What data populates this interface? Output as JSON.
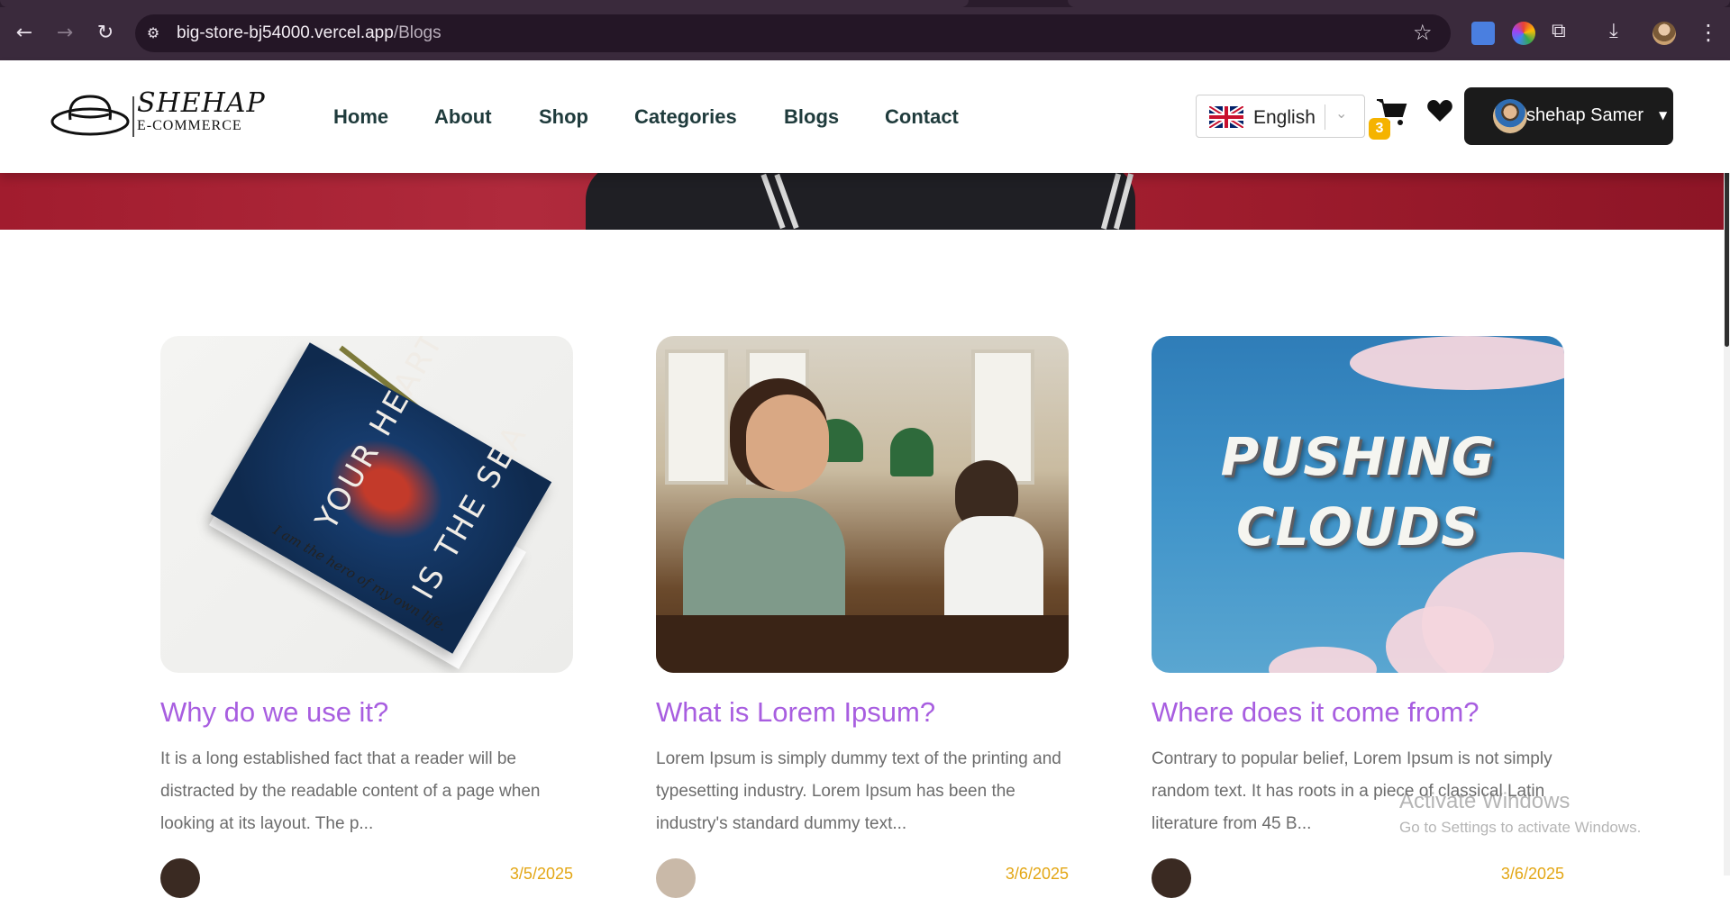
{
  "browser": {
    "url_host": "big-store-bj54000.vercel.app",
    "url_path": "/Blogs"
  },
  "site": {
    "logo_title": "SHEHAP",
    "logo_subtitle": "E-COMMERCE",
    "nav": [
      {
        "label": "Home"
      },
      {
        "label": "About"
      },
      {
        "label": "Shop"
      },
      {
        "label": "Categories"
      },
      {
        "label": "Blogs"
      },
      {
        "label": "Contact"
      }
    ],
    "language": "English",
    "cart_count": "3",
    "user_name": "shehap Samer",
    "colors": {
      "title_purple": "#a85ee0",
      "date_orange": "#e3a614",
      "nav_text": "#1f3b3c"
    }
  },
  "blogs": [
    {
      "image_text": [
        "YOUR HEART",
        "IS THE SEA",
        "I am the hero of my own life."
      ],
      "title": "Why do we use it?",
      "excerpt": "It is a long established fact that a reader will be distracted by the readable content of a page when looking at its layout. The p...",
      "date": "3/5/2025"
    },
    {
      "title": "What is Lorem Ipsum?",
      "excerpt": "Lorem Ipsum is simply dummy text of the printing and typesetting industry. Lorem Ipsum has been the industry's standard dummy text...",
      "date": "3/6/2025"
    },
    {
      "image_text": [
        "PUSHING",
        "CLOUDS"
      ],
      "title": "Where does it come from?",
      "excerpt": "Contrary to popular belief, Lorem Ipsum is not simply random text. It has roots in a piece of classical Latin literature from 45 B...",
      "date": "3/6/2025"
    }
  ],
  "watermark": {
    "line1": "Activate Windows",
    "line2": "Go to Settings to activate Windows."
  }
}
